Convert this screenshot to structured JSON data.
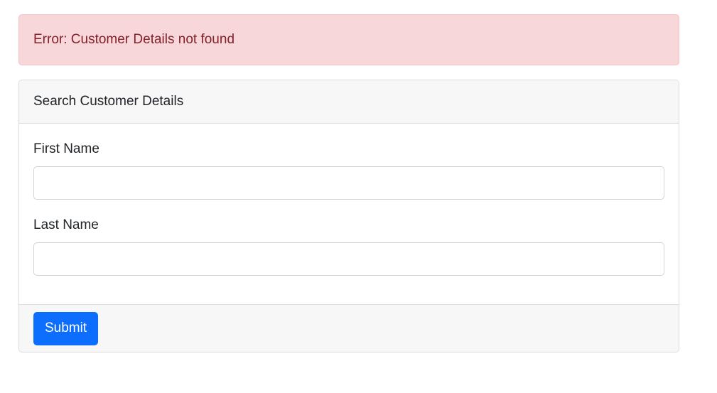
{
  "colors": {
    "alert_bg": "#f8d7da",
    "alert_text": "#842029",
    "primary": "#0d6efd"
  },
  "alert": {
    "message": "Error: Customer Details not found"
  },
  "search_card": {
    "title": "Search Customer Details",
    "fields": [
      {
        "label": "First Name",
        "value": "",
        "placeholder": ""
      },
      {
        "label": "Last Name",
        "value": "",
        "placeholder": ""
      }
    ],
    "submit_label": "Submit"
  }
}
